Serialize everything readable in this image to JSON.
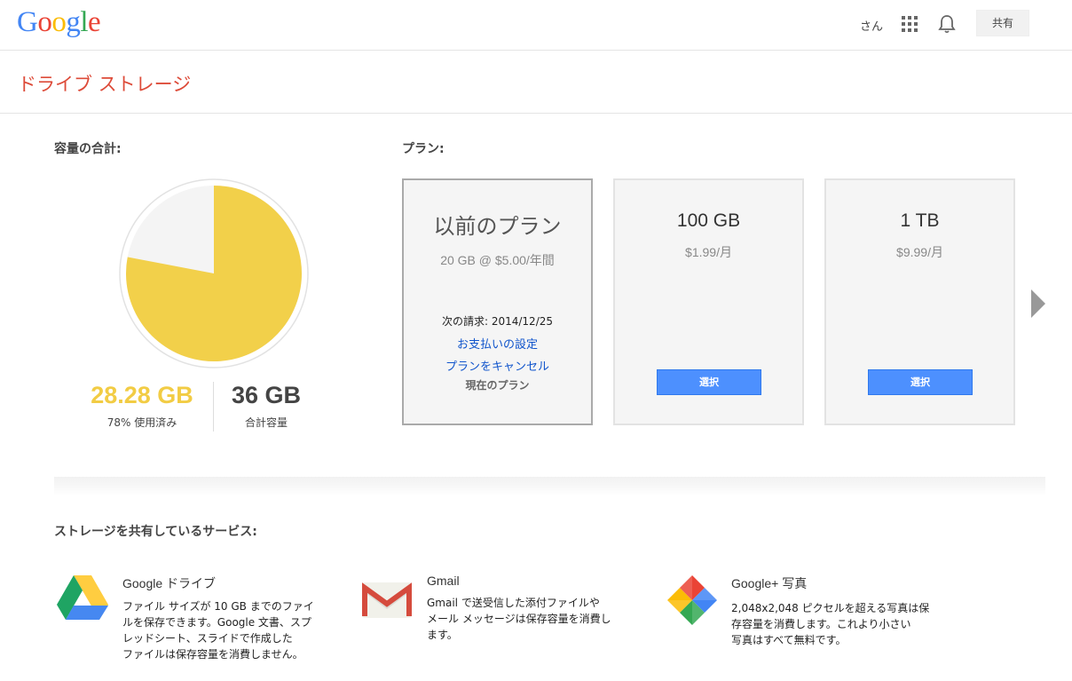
{
  "header": {
    "logo_letters": [
      {
        "ch": "G",
        "color": "#4285f4"
      },
      {
        "ch": "o",
        "color": "#ea4335"
      },
      {
        "ch": "o",
        "color": "#fbbc05"
      },
      {
        "ch": "g",
        "color": "#4285f4"
      },
      {
        "ch": "l",
        "color": "#34a853"
      },
      {
        "ch": "e",
        "color": "#ea4335"
      }
    ],
    "user_name": "さん",
    "apps_icon": "apps-grid-icon",
    "notifications_icon": "bell-icon",
    "share_label": "共有"
  },
  "page": {
    "title": "ドライブ ストレージ"
  },
  "storage": {
    "section_label": "容量の合計:",
    "used": "28.28 GB",
    "used_caption": "78% 使用済み",
    "used_fraction": 0.78,
    "total": "36 GB",
    "total_caption": "合計容量",
    "colors": {
      "used": "#f2d04a",
      "free": "#f4f4f4"
    }
  },
  "plans": {
    "section_label": "プラン:",
    "current": {
      "name": "以前のプラン",
      "price": "20 GB @ $5.00/年間",
      "billing": "次の請求: 2014/12/25",
      "payment_link": "お支払いの設定",
      "cancel_link": "プランをキャンセル",
      "status": "現在のプラン"
    },
    "options": [
      {
        "name": "100 GB",
        "price": "$1.99/月",
        "button": "選択"
      },
      {
        "name": "1 TB",
        "price": "$9.99/月",
        "button": "選択"
      }
    ],
    "next_icon": "chevron-right-icon"
  },
  "services": {
    "section_label": "ストレージを共有しているサービス:",
    "items": [
      {
        "icon": "google-drive-icon",
        "title": "Google ドライブ",
        "desc_lines": [
          "ファイル サイズが 10 GB までのファイ",
          "ルを保存できます。Google 文書、スプ",
          "レッドシート、スライドで作成した",
          "ファイルは保存容量を消費しません。"
        ]
      },
      {
        "icon": "gmail-icon",
        "title": "Gmail",
        "desc_lines": [
          "Gmail で送受信した添付ファイルや",
          "メール メッセージは保存容量を消費し",
          "ます。"
        ]
      },
      {
        "icon": "google-photos-icon",
        "title": "Google+ 写真",
        "desc_lines": [
          "2,048x2,048 ピクセルを超える写真は保",
          "存容量を消費します。これより小さい",
          "写真はすべて無料です。"
        ]
      }
    ]
  }
}
